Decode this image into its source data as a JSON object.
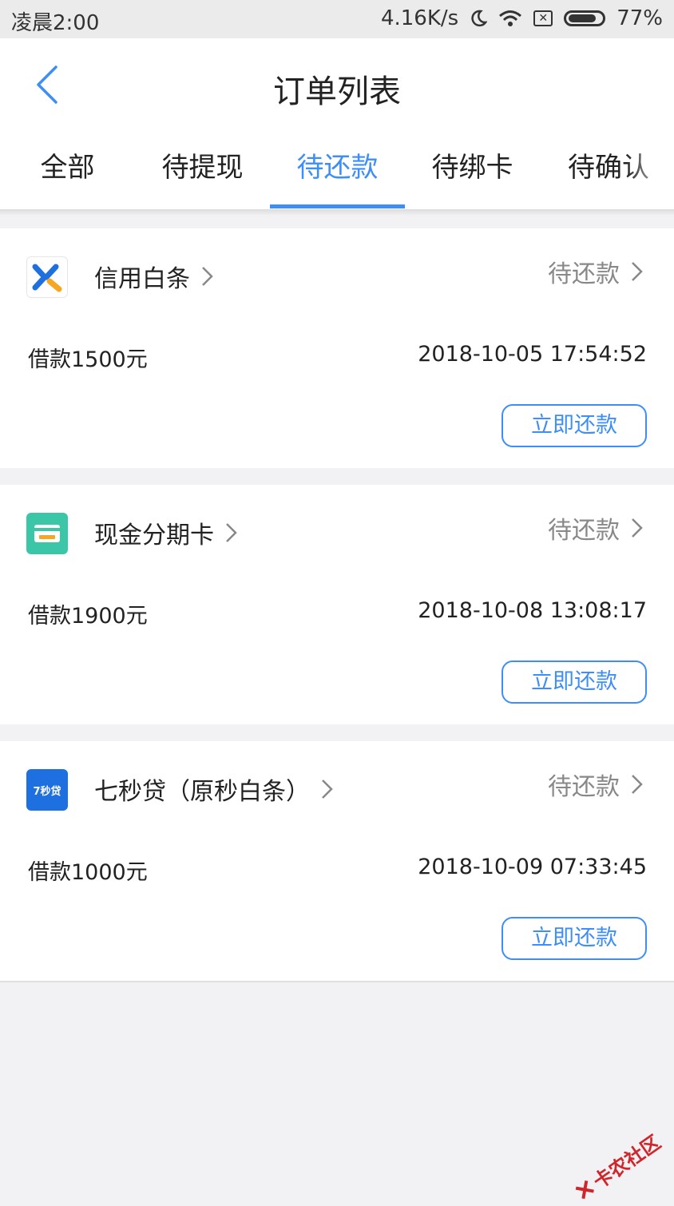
{
  "status_bar": {
    "time": "凌晨2:00",
    "speed": "4.16K/s",
    "battery": "77%"
  },
  "header": {
    "title": "订单列表"
  },
  "tabs": [
    {
      "label": "全部"
    },
    {
      "label": "待提现"
    },
    {
      "label": "待还款"
    },
    {
      "label": "待绑卡"
    },
    {
      "label": "待确认"
    }
  ],
  "active_tab": "待还款",
  "orders": [
    {
      "name": "信用白条",
      "status": "待还款",
      "amount": "借款1500元",
      "datetime": "2018-10-05 17:54:52",
      "button": "立即还款",
      "logo_text": "X"
    },
    {
      "name": "现金分期卡",
      "status": "待还款",
      "amount": "借款1900元",
      "datetime": "2018-10-08 13:08:17",
      "button": "立即还款",
      "logo_text": "分期卡"
    },
    {
      "name": "七秒贷（原秒白条）",
      "status": "待还款",
      "amount": "借款1000元",
      "datetime": "2018-10-09 07:33:45",
      "button": "立即还款",
      "logo_text": "7秒贷"
    }
  ],
  "watermark": "卡农社区",
  "colors": {
    "accent": "#3e8ef7",
    "background": "#f2f2f4",
    "status_text": "#888888"
  }
}
